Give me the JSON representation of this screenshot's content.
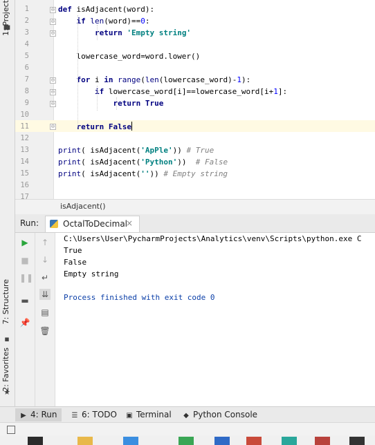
{
  "left_strip": {
    "project_tab": "1: Project",
    "structure_tab": "7: Structure",
    "favorites_tab": "2: Favorites"
  },
  "editor": {
    "line_numbers": [
      "1",
      "2",
      "3",
      "4",
      "5",
      "6",
      "7",
      "8",
      "9",
      "10",
      "11",
      "12",
      "13",
      "14",
      "15",
      "16",
      "17"
    ],
    "lines": [
      {
        "parts": [
          {
            "t": "def ",
            "c": "kw"
          },
          {
            "t": "isAdjacent(word):",
            "c": "fn"
          }
        ]
      },
      {
        "parts": [
          {
            "t": "    "
          },
          {
            "t": "if ",
            "c": "kw"
          },
          {
            "t": "len",
            "c": "builtin"
          },
          {
            "t": "(word)=="
          },
          {
            "t": "0",
            "c": "num"
          },
          {
            "t": ":"
          }
        ]
      },
      {
        "parts": [
          {
            "t": "        "
          },
          {
            "t": "return ",
            "c": "kw"
          },
          {
            "t": "'Empty string'",
            "c": "str"
          }
        ]
      },
      {
        "parts": []
      },
      {
        "parts": [
          {
            "t": "    lowercase_word=word.lower()"
          }
        ]
      },
      {
        "parts": []
      },
      {
        "parts": [
          {
            "t": "    "
          },
          {
            "t": "for ",
            "c": "kw"
          },
          {
            "t": "i "
          },
          {
            "t": "in ",
            "c": "kw"
          },
          {
            "t": "range",
            "c": "builtin"
          },
          {
            "t": "("
          },
          {
            "t": "len",
            "c": "builtin"
          },
          {
            "t": "(lowercase_word)-"
          },
          {
            "t": "1",
            "c": "num"
          },
          {
            "t": "):"
          }
        ]
      },
      {
        "parts": [
          {
            "t": "        "
          },
          {
            "t": "if ",
            "c": "kw"
          },
          {
            "t": "lowercase_word[i]==lowercase_word[i+"
          },
          {
            "t": "1",
            "c": "num"
          },
          {
            "t": "]:"
          }
        ]
      },
      {
        "parts": [
          {
            "t": "            "
          },
          {
            "t": "return ",
            "c": "kw"
          },
          {
            "t": "True",
            "c": "kw"
          }
        ]
      },
      {
        "parts": []
      },
      {
        "parts": [
          {
            "t": "    "
          },
          {
            "t": "return ",
            "c": "kw"
          },
          {
            "t": "False",
            "c": "kw"
          }
        ]
      },
      {
        "parts": []
      },
      {
        "parts": [
          {
            "t": "print",
            "c": "builtin"
          },
          {
            "t": "( isAdjacent("
          },
          {
            "t": "'ApPle'",
            "c": "str"
          },
          {
            "t": ")) "
          },
          {
            "t": "# True",
            "c": "cm"
          }
        ]
      },
      {
        "parts": [
          {
            "t": "print",
            "c": "builtin"
          },
          {
            "t": "( isAdjacent("
          },
          {
            "t": "'Python'",
            "c": "str"
          },
          {
            "t": "))  "
          },
          {
            "t": "# False",
            "c": "cm"
          }
        ]
      },
      {
        "parts": [
          {
            "t": "print",
            "c": "builtin"
          },
          {
            "t": "( isAdjacent("
          },
          {
            "t": "''",
            "c": "str"
          },
          {
            "t": ")) "
          },
          {
            "t": "# Empty string",
            "c": "cm"
          }
        ]
      },
      {
        "parts": []
      },
      {
        "parts": []
      }
    ],
    "caret_line": "11"
  },
  "breadcrumb": "isAdjacent()",
  "run": {
    "label": "Run:",
    "tab_name": "OctalToDecimal",
    "console_lines": [
      "C:\\Users\\User\\PycharmProjects\\Analytics\\venv\\Scripts\\python.exe C",
      "True",
      "False",
      "Empty string",
      "",
      "Process finished with exit code 0"
    ]
  },
  "bottom_tabs": {
    "run": "4: Run",
    "todo": "6: TODO",
    "terminal": "Terminal",
    "python_console": "Python Console"
  }
}
